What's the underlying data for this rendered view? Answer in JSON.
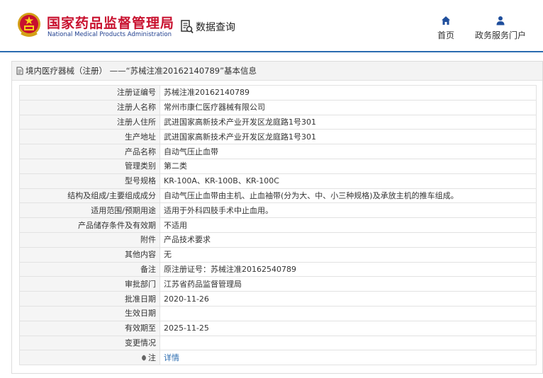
{
  "header": {
    "logo_cn": "国家药品监督管理局",
    "logo_en": "National Medical Products Administration",
    "emblem_icon": "national-emblem-icon",
    "data_query_label": "数据查询",
    "nav": [
      {
        "label": "首页",
        "icon": "home-icon"
      },
      {
        "label": "政务服务门户",
        "icon": "user-icon"
      }
    ]
  },
  "panel": {
    "title": "境内医疗器械（注册） ——“苏械注准20162140789”基本信息",
    "rows": [
      {
        "key": "注册证编号",
        "value": "苏械注准20162140789"
      },
      {
        "key": "注册人名称",
        "value": "常州市康仁医疗器械有限公司"
      },
      {
        "key": "注册人住所",
        "value": "武进国家高新技术产业开发区龙庭路1号301"
      },
      {
        "key": "生产地址",
        "value": "武进国家高新技术产业开发区龙庭路1号301"
      },
      {
        "key": "产品名称",
        "value": "自动气压止血带"
      },
      {
        "key": "管理类别",
        "value": "第二类"
      },
      {
        "key": "型号规格",
        "value": "KR-100A、KR-100B、KR-100C"
      },
      {
        "key": "结构及组成/主要组成成分",
        "value": "自动气压止血带由主机、止血袖带(分为大、中、小三种规格)及承放主机的推车组成。"
      },
      {
        "key": "适用范围/预期用途",
        "value": "适用于外科四肢手术中止血用。"
      },
      {
        "key": "产品储存条件及有效期",
        "value": "不适用"
      },
      {
        "key": "附件",
        "value": "产品技术要求"
      },
      {
        "key": "其他内容",
        "value": "无"
      },
      {
        "key": "备注",
        "value": "原注册证号：苏械注准20162540789"
      },
      {
        "key": "审批部门",
        "value": "江苏省药品监督管理局"
      },
      {
        "key": "批准日期",
        "value": "2020-11-26"
      },
      {
        "key": "生效日期",
        "value": ""
      },
      {
        "key": "有效期至",
        "value": "2025-11-25"
      },
      {
        "key": "变更情况",
        "value": ""
      }
    ],
    "note_key": "注",
    "note_link": "详情"
  }
}
